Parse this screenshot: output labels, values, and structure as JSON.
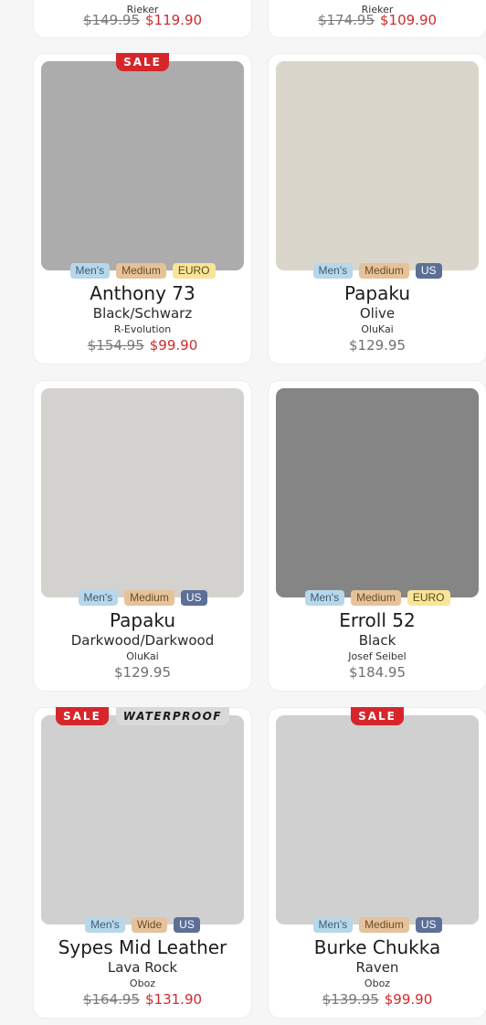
{
  "colors": {
    "sale_red": "#d6262c",
    "price_red": "#cf2b2b",
    "tag_gender": "#b7d7ea",
    "tag_width": "#e6c29a",
    "tag_us": "#5c6f97",
    "tag_euro": "#f8e49a"
  },
  "partial_row": [
    {
      "brand": "Rieker",
      "old_price": "$149.95",
      "price": "$119.90"
    },
    {
      "brand": "Rieker",
      "old_price": "$174.95",
      "price": "$109.90"
    }
  ],
  "products": [
    {
      "badges": [
        "SALE"
      ],
      "image_color": "#acacac",
      "tags": {
        "gender": "Men's",
        "width": "Medium",
        "region": "EURO"
      },
      "name": "Anthony 73",
      "color": "Black/Schwarz",
      "brand": "R-Evolution",
      "old_price": "$154.95",
      "price": "$99.90"
    },
    {
      "badges": [],
      "image_color": "#dbd6cc",
      "tags": {
        "gender": "Men's",
        "width": "Medium",
        "region": "US"
      },
      "name": "Papaku",
      "color": "Olive",
      "brand": "OluKai",
      "old_price": "",
      "price": "$129.95"
    },
    {
      "badges": [],
      "image_color": "#d3d2ce",
      "tags": {
        "gender": "Men's",
        "width": "Medium",
        "region": "US"
      },
      "name": "Papaku",
      "color": "Darkwood/Darkwood",
      "brand": "OluKai",
      "old_price": "",
      "price": "$129.95"
    },
    {
      "badges": [],
      "image_color": "#858585",
      "tags": {
        "gender": "Men's",
        "width": "Medium",
        "region": "EURO"
      },
      "name": "Erroll 52",
      "color": "Black",
      "brand": "Josef Seibel",
      "old_price": "",
      "price": "$184.95"
    },
    {
      "badges": [
        "SALE",
        "WATERPROOF"
      ],
      "image_color": "#d0d0d0",
      "tags": {
        "gender": "Men's",
        "width": "Wide",
        "region": "US"
      },
      "name": "Sypes Mid Leather",
      "color": "Lava Rock",
      "brand": "Oboz",
      "old_price": "$164.95",
      "price": "$131.90"
    },
    {
      "badges": [
        "SALE"
      ],
      "image_color": "#d0d0d0",
      "tags": {
        "gender": "Men's",
        "width": "Medium",
        "region": "US"
      },
      "name": "Burke Chukka",
      "color": "Raven",
      "brand": "Oboz",
      "old_price": "$139.95",
      "price": "$99.90"
    }
  ]
}
